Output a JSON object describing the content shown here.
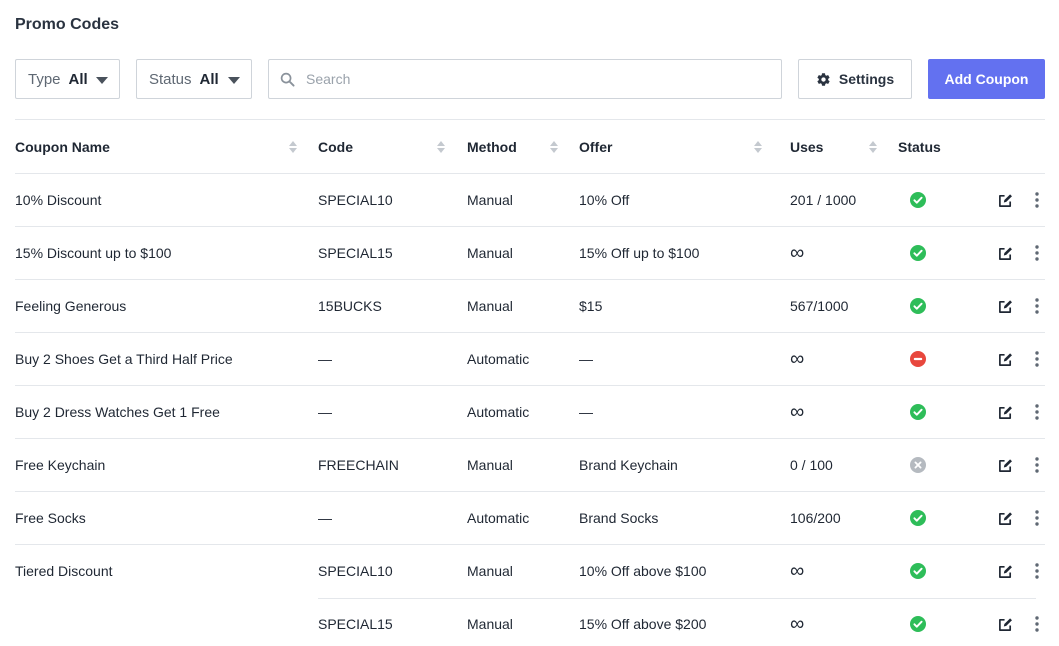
{
  "page": {
    "title": "Promo Codes"
  },
  "filters": {
    "type": {
      "label": "Type",
      "value": "All"
    },
    "status": {
      "label": "Status",
      "value": "All"
    }
  },
  "search": {
    "placeholder": "Search",
    "value": ""
  },
  "toolbar": {
    "settings_label": "Settings",
    "add_label": "Add Coupon",
    "accent_color": "#6371f0"
  },
  "table": {
    "columns": [
      "Coupon Name",
      "Code",
      "Method",
      "Offer",
      "Uses",
      "Status"
    ],
    "rows": [
      {
        "name": "10% Discount",
        "code": "SPECIAL10",
        "method": "Manual",
        "offer": "10% Off",
        "uses": "201 / 1000",
        "status": "active"
      },
      {
        "name": "15% Discount up to $100",
        "code": "SPECIAL15",
        "method": "Manual",
        "offer": "15% Off up to $100",
        "uses": "∞",
        "status": "active"
      },
      {
        "name": "Feeling Generous",
        "code": "15BUCKS",
        "method": "Manual",
        "offer": "$15",
        "uses": "567/1000",
        "status": "active"
      },
      {
        "name": "Buy 2 Shoes Get a Third Half Price",
        "code": "—",
        "method": "Automatic",
        "offer": "—",
        "uses": "∞",
        "status": "blocked"
      },
      {
        "name": "Buy 2 Dress Watches Get 1 Free",
        "code": "—",
        "method": "Automatic",
        "offer": "—",
        "uses": "∞",
        "status": "active"
      },
      {
        "name": "Free Keychain",
        "code": "FREECHAIN",
        "method": "Manual",
        "offer": "Brand Keychain",
        "uses": "0 / 100",
        "status": "inactive"
      },
      {
        "name": "Free Socks",
        "code": "—",
        "method": "Automatic",
        "offer": "Brand Socks",
        "uses": "106/200",
        "status": "active"
      },
      {
        "name": "Tiered Discount",
        "code": "SPECIAL10",
        "method": "Manual",
        "offer": "10% Off above $100",
        "uses": "∞",
        "status": "active"
      },
      {
        "name": "",
        "code": "SPECIAL15",
        "method": "Manual",
        "offer": "15% Off above $200",
        "uses": "∞",
        "status": "active"
      }
    ]
  },
  "status_colors": {
    "active": "#2ebd59",
    "blocked": "#e8473d",
    "inactive": "#b5bac0"
  },
  "icons": {
    "search": "search-icon",
    "settings": "gear-icon",
    "edit": "edit-icon",
    "more": "more-vertical-icon",
    "sort": "sort-icon"
  }
}
